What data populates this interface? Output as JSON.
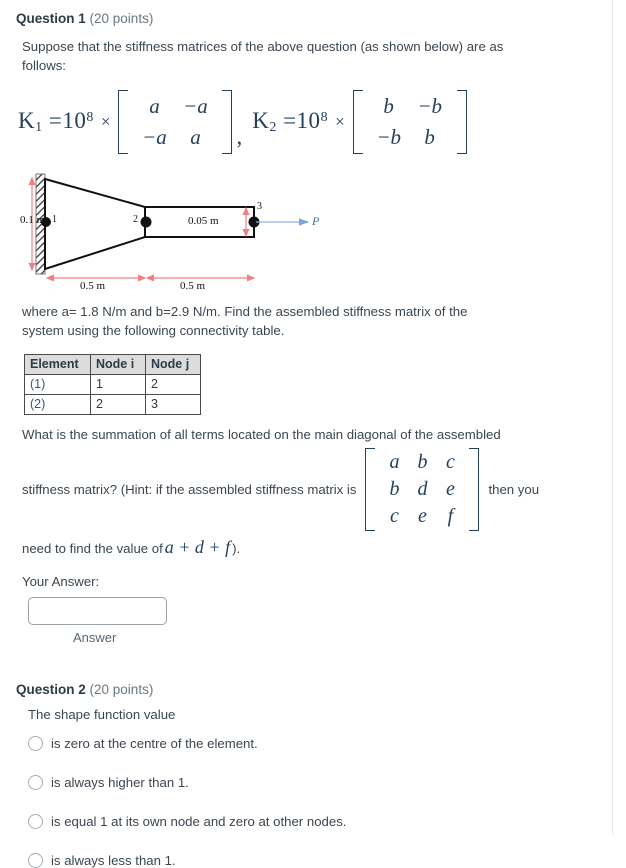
{
  "question1": {
    "name": "Question 1",
    "points": "(20 points)",
    "intro": "Suppose that the stiffness matrices of the above question (as shown below) are as follows:",
    "formula": {
      "k1_label": "K",
      "k1_sub": "1",
      "k1_eq": "=10",
      "k1_exp": "8",
      "times": "×",
      "k1_matrix": [
        "a",
        "−a",
        "−a",
        "a"
      ],
      "comma": ",",
      "k2_label": "K",
      "k2_sub": "2",
      "k2_eq": "=10",
      "k2_exp": "8",
      "k2_matrix": [
        "b",
        "−b",
        "−b",
        "b"
      ]
    },
    "figure": {
      "height_left_label": "0.1 m",
      "height_right_label": "0.05 m",
      "span1_label": "0.5 m",
      "span2_label": "0.5 m",
      "node1": "1",
      "node2": "2",
      "node3": "3",
      "force_label": "P",
      "colors": {
        "dimension": "#f08080",
        "force_arrow": "#8cb4dd",
        "outline": "#111111"
      }
    },
    "where_text": "where a= 1.8 N/m and b=2.9 N/m. Find the assembled stiffness matrix of the system using the following connectivity table.",
    "table": {
      "headers": [
        "Element",
        "Node i",
        "Node j"
      ],
      "rows": [
        [
          "(1)",
          "1",
          "2"
        ],
        [
          "(2)",
          "2",
          "3"
        ]
      ]
    },
    "question_line1": "What is the summation of all terms located on the main diagonal of the assembled",
    "question_line2a": "stiffness matrix? (Hint: if the assembled stiffness matrix is",
    "hint_matrix": [
      "a",
      "b",
      "c",
      "b",
      "d",
      "e",
      "c",
      "e",
      "f"
    ],
    "question_line2b": "then you",
    "need_prefix": "need to find the value of",
    "need_expr": "a + d + f",
    "need_suffix": ").",
    "your_answer_label": "Your Answer:",
    "answer_value": "",
    "answer_placeholder": "",
    "answer_caption": "Answer"
  },
  "question2": {
    "name": "Question 2",
    "points": "(20 points)",
    "stem": "The shape function value",
    "choices": [
      "is zero at the centre of the element.",
      "is always higher than 1.",
      "is equal 1 at its own node and zero at other nodes.",
      "is always less than 1."
    ]
  }
}
